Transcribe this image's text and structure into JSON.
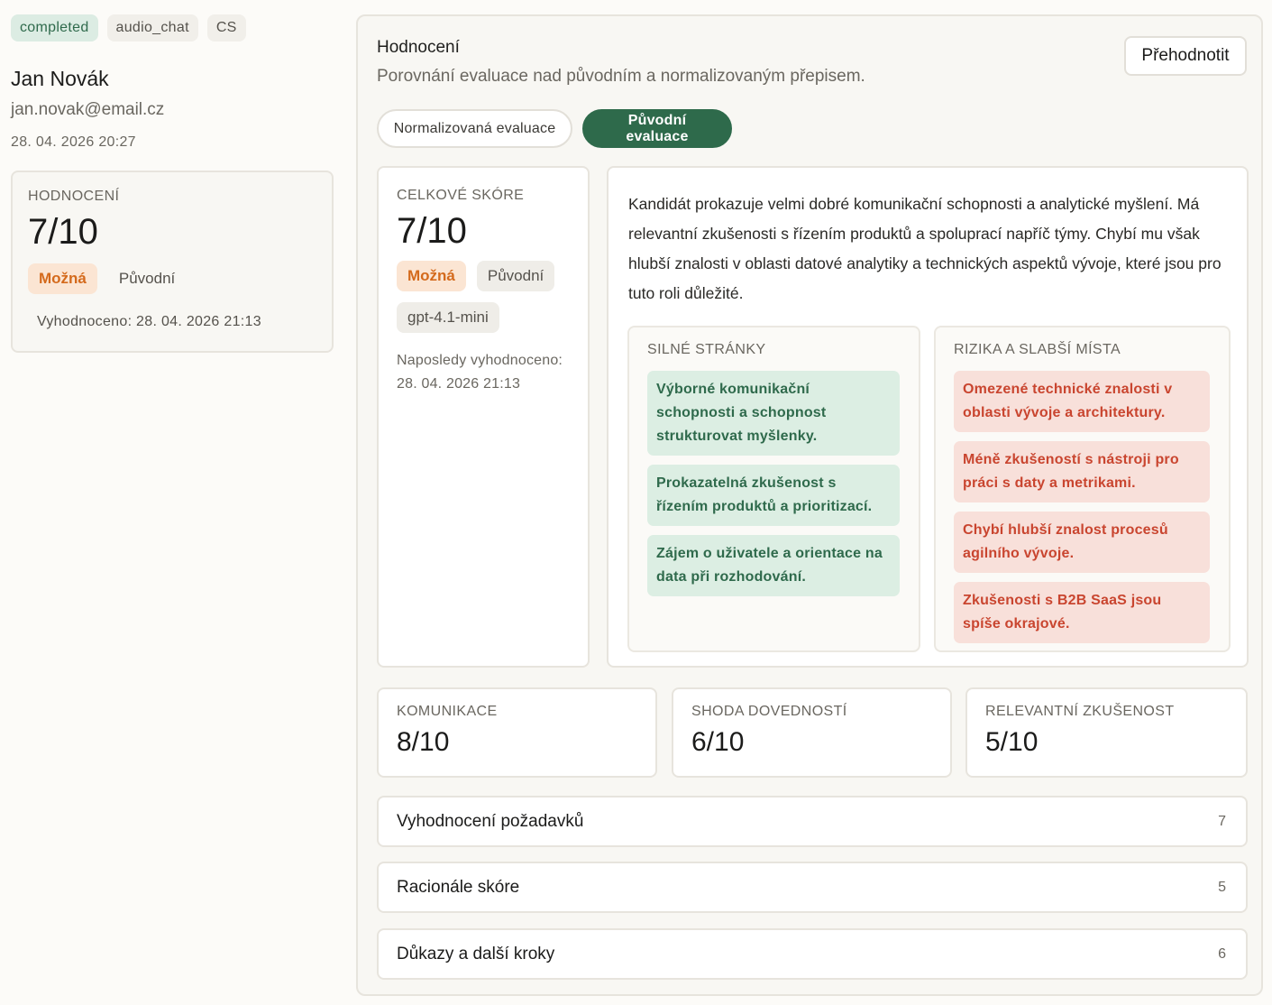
{
  "tags": [
    "completed",
    "audio_chat",
    "CS"
  ],
  "candidate": {
    "name": "Jan Novák",
    "email": "jan.novak@email.cz",
    "created": "28. 04. 2026 20:27"
  },
  "side_score": {
    "label": "HODNOCENÍ",
    "value": "7/10",
    "verdict": "Možná",
    "source": "Původní",
    "evaluated": "Vyhodnoceno: 28. 04. 2026 21:13"
  },
  "panel": {
    "title": "Hodnocení",
    "subtitle": "Porovnání evaluace nad původním a normalizovaným přepisem.",
    "reevaluate_label": "Přehodnotit",
    "toggle_normalized": "Normalizovaná evaluace",
    "toggle_original": "Původní evaluace"
  },
  "total": {
    "label": "CELKOVÉ SKÓRE",
    "value": "7/10",
    "verdict": "Možná",
    "source": "Původní",
    "model": "gpt-4.1-mini",
    "last_eval_label": "Naposledy vyhodnoceno:",
    "last_eval_date": "28. 04. 2026 21:13"
  },
  "summary": "Kandidát prokazuje velmi dobré komunikační schopnosti a analytické myšlení. Má relevantní zkušenosti s řízením produktů a spoluprací napříč týmy. Chybí mu však hlubší znalosti v oblasti datové analytiky a technických aspektů vývoje, které jsou pro tuto roli důležité.",
  "strengths": {
    "label": "SILNÉ STRÁNKY",
    "items": [
      "Výborné komunikační schopnosti a schopnost strukturovat myšlenky.",
      "Prokazatelná zkušenost s řízením produktů a prioritizací.",
      "Zájem o uživatele a orientace na data při rozhodování."
    ]
  },
  "risks": {
    "label": "RIZIKA A SLABŠÍ MÍSTA",
    "items": [
      "Omezené technické znalosti v oblasti vývoje a architektury.",
      "Méně zkušeností s nástroji pro práci s daty a metrikami.",
      "Chybí hlubší znalost procesů agilního vývoje.",
      "Zkušenosti s B2B SaaS jsou spíše okrajové."
    ]
  },
  "metrics": [
    {
      "label": "KOMUNIKACE",
      "value": "8/10"
    },
    {
      "label": "SHODA DOVEDNOSTÍ",
      "value": "6/10"
    },
    {
      "label": "RELEVANTNÍ ZKUŠENOST",
      "value": "5/10"
    }
  ],
  "sections": [
    {
      "label": "Vyhodnocení požadavků",
      "count": "7"
    },
    {
      "label": "Racionále skóre",
      "count": "5"
    },
    {
      "label": "Důkazy a další kroky",
      "count": "6"
    }
  ],
  "colors": {
    "accent_green": "#2e6a4b",
    "status_green_bg": "#dcece3",
    "verdict_orange": "#d46a1c",
    "risk_red": "#c9452f"
  }
}
